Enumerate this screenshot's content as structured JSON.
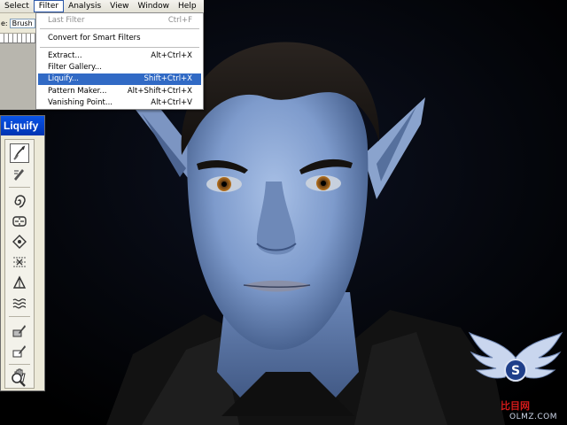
{
  "menubar": {
    "items": [
      "Select",
      "Filter",
      "Analysis",
      "View",
      "Window",
      "Help"
    ],
    "active": "Filter"
  },
  "options_bar": {
    "label": "e:",
    "brush": "Brush"
  },
  "filter_menu": {
    "items": [
      {
        "label": "Last Filter",
        "shortcut": "Ctrl+F",
        "state": "disabled"
      },
      {
        "label": "Convert for Smart Filters",
        "shortcut": "",
        "state": "normal"
      },
      {
        "label": "Extract...",
        "shortcut": "Alt+Ctrl+X",
        "state": "normal"
      },
      {
        "label": "Filter Gallery...",
        "shortcut": "",
        "state": "normal"
      },
      {
        "label": "Liquify...",
        "shortcut": "Shift+Ctrl+X",
        "state": "highlighted"
      },
      {
        "label": "Pattern Maker...",
        "shortcut": "Alt+Shift+Ctrl+X",
        "state": "normal"
      },
      {
        "label": "Vanishing Point...",
        "shortcut": "Alt+Ctrl+V",
        "state": "normal"
      }
    ]
  },
  "liquify_panel": {
    "title": "Liquify",
    "tools": [
      {
        "name": "forward-warp-tool",
        "selected": true
      },
      {
        "name": "reconstruct-tool",
        "selected": false
      },
      {
        "name": "twirl-clockwise-tool",
        "selected": false
      },
      {
        "name": "pucker-tool",
        "selected": false
      },
      {
        "name": "bloat-tool",
        "selected": false
      },
      {
        "name": "push-left-tool",
        "selected": false
      },
      {
        "name": "mirror-tool",
        "selected": false
      },
      {
        "name": "turbulence-tool",
        "selected": false
      },
      {
        "name": "freeze-mask-tool",
        "selected": false
      },
      {
        "name": "thaw-mask-tool",
        "selected": false
      },
      {
        "name": "hand-tool",
        "selected": false
      },
      {
        "name": "zoom-tool",
        "selected": false
      }
    ]
  },
  "watermark": {
    "cn_text": "比目网",
    "site": "OLMZ.COM"
  },
  "colors": {
    "highlight": "#316ac5",
    "skin": "#7e9ccf",
    "title_bar": "#0a54e6"
  }
}
